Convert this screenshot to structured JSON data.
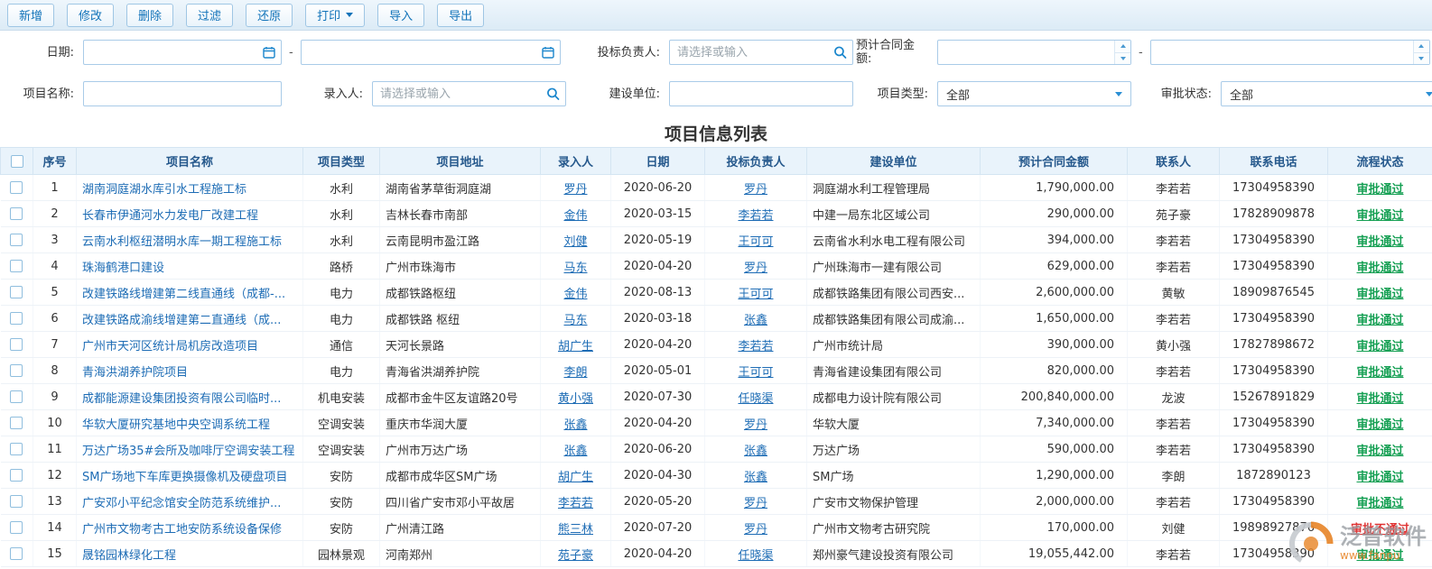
{
  "toolbar": {
    "buttons": [
      {
        "id": "add",
        "label": "新增",
        "dropdown": false
      },
      {
        "id": "edit",
        "label": "修改",
        "dropdown": false
      },
      {
        "id": "delete",
        "label": "删除",
        "dropdown": false
      },
      {
        "id": "filter",
        "label": "过滤",
        "dropdown": false
      },
      {
        "id": "restore",
        "label": "还原",
        "dropdown": false
      },
      {
        "id": "print",
        "label": "打印",
        "dropdown": true
      },
      {
        "id": "import",
        "label": "导入",
        "dropdown": false
      },
      {
        "id": "export",
        "label": "导出",
        "dropdown": false
      }
    ]
  },
  "filters": {
    "date_label": "日期:",
    "range_separator": "-",
    "bid_manager_label": "投标负责人:",
    "select_placeholder": "请选择或输入",
    "amount_label": "预计合同金额:",
    "project_name_label": "项目名称:",
    "entry_person_label": "录入人:",
    "construction_unit_label": "建设单位:",
    "project_type_label": "项目类型:",
    "project_type_value": "全部",
    "approval_status_label": "审批状态:",
    "approval_status_value": "全部"
  },
  "page_title": "项目信息列表",
  "table": {
    "columns": [
      "序号",
      "项目名称",
      "项目类型",
      "项目地址",
      "录入人",
      "日期",
      "投标负责人",
      "建设单位",
      "预计合同金额",
      "联系人",
      "联系电话",
      "流程状态"
    ],
    "rows": [
      {
        "no": "1",
        "name": "湖南洞庭湖水库引水工程施工标",
        "type": "水利",
        "address": "湖南省茅草街洞庭湖",
        "entry": "罗丹",
        "date": "2020-06-20",
        "bid": "罗丹",
        "unit": "洞庭湖水利工程管理局",
        "amount": "1,790,000.00",
        "contact": "李若若",
        "phone": "17304958390",
        "status": "审批通过",
        "status_state": "pass"
      },
      {
        "no": "2",
        "name": "长春市伊通河水力发电厂改建工程",
        "type": "水利",
        "address": "吉林长春市南部",
        "entry": "金伟",
        "date": "2020-03-15",
        "bid": "李若若",
        "unit": "中建一局东北区域公司",
        "amount": "290,000.00",
        "contact": "苑子豪",
        "phone": "17828909878",
        "status": "审批通过",
        "status_state": "pass"
      },
      {
        "no": "3",
        "name": "云南水利枢纽潜明水库一期工程施工标",
        "type": "水利",
        "address": "云南昆明市盈江路",
        "entry": "刘健",
        "date": "2020-05-19",
        "bid": "王可可",
        "unit": "云南省水利水电工程有限公司",
        "amount": "394,000.00",
        "contact": "李若若",
        "phone": "17304958390",
        "status": "审批通过",
        "status_state": "pass"
      },
      {
        "no": "4",
        "name": "珠海鹤港口建设",
        "type": "路桥",
        "address": "广州市珠海市",
        "entry": "马东",
        "date": "2020-04-20",
        "bid": "罗丹",
        "unit": "广州珠海市一建有限公司",
        "amount": "629,000.00",
        "contact": "李若若",
        "phone": "17304958390",
        "status": "审批通过",
        "status_state": "pass"
      },
      {
        "no": "5",
        "name": "改建铁路线增建第二线直通线（成都-...",
        "type": "电力",
        "address": "成都铁路枢纽",
        "entry": "金伟",
        "date": "2020-08-13",
        "bid": "王可可",
        "unit": "成都铁路集团有限公司西安...",
        "amount": "2,600,000.00",
        "contact": "黄敏",
        "phone": "18909876545",
        "status": "审批通过",
        "status_state": "pass"
      },
      {
        "no": "6",
        "name": "改建铁路成渝线增建第二直通线（成...",
        "type": "电力",
        "address": "成都铁路 枢纽",
        "entry": "马东",
        "date": "2020-03-18",
        "bid": "张鑫",
        "unit": "成都铁路集团有限公司成渝...",
        "amount": "1,650,000.00",
        "contact": "李若若",
        "phone": "17304958390",
        "status": "审批通过",
        "status_state": "pass"
      },
      {
        "no": "7",
        "name": "广州市天河区统计局机房改造项目",
        "type": "通信",
        "address": "天河长景路",
        "entry": "胡广生",
        "date": "2020-04-20",
        "bid": "李若若",
        "unit": "广州市统计局",
        "amount": "390,000.00",
        "contact": "黄小强",
        "phone": "17827898672",
        "status": "审批通过",
        "status_state": "pass"
      },
      {
        "no": "8",
        "name": "青海洪湖养护院项目",
        "type": "电力",
        "address": "青海省洪湖养护院",
        "entry": "李朗",
        "date": "2020-05-01",
        "bid": "王可可",
        "unit": "青海省建设集团有限公司",
        "amount": "820,000.00",
        "contact": "李若若",
        "phone": "17304958390",
        "status": "审批通过",
        "status_state": "pass"
      },
      {
        "no": "9",
        "name": "成都能源建设集团投资有限公司临时...",
        "type": "机电安装",
        "address": "成都市金牛区友谊路20号",
        "entry": "黄小强",
        "date": "2020-07-30",
        "bid": "任晓渠",
        "unit": "成都电力设计院有限公司",
        "amount": "200,840,000.00",
        "contact": "龙波",
        "phone": "15267891829",
        "status": "审批通过",
        "status_state": "pass"
      },
      {
        "no": "10",
        "name": "华软大厦研究基地中央空调系统工程",
        "type": "空调安装",
        "address": "重庆市华润大厦",
        "entry": "张鑫",
        "date": "2020-04-20",
        "bid": "罗丹",
        "unit": "华软大厦",
        "amount": "7,340,000.00",
        "contact": "李若若",
        "phone": "17304958390",
        "status": "审批通过",
        "status_state": "pass"
      },
      {
        "no": "11",
        "name": "万达广场35#会所及咖啡厅空调安装工程",
        "type": "空调安装",
        "address": "广州市万达广场",
        "entry": "张鑫",
        "date": "2020-06-20",
        "bid": "张鑫",
        "unit": "万达广场",
        "amount": "590,000.00",
        "contact": "李若若",
        "phone": "17304958390",
        "status": "审批通过",
        "status_state": "pass"
      },
      {
        "no": "12",
        "name": "SM广场地下车库更换摄像机及硬盘项目",
        "type": "安防",
        "address": "成都市成华区SM广场",
        "entry": "胡广生",
        "date": "2020-04-30",
        "bid": "张鑫",
        "unit": "SM广场",
        "amount": "1,290,000.00",
        "contact": "李朗",
        "phone": "1872890123",
        "status": "审批通过",
        "status_state": "pass"
      },
      {
        "no": "13",
        "name": "广安邓小平纪念馆安全防范系统维护...",
        "type": "安防",
        "address": "四川省广安市邓小平故居",
        "entry": "李若若",
        "date": "2020-05-20",
        "bid": "罗丹",
        "unit": "广安市文物保护管理",
        "amount": "2,000,000.00",
        "contact": "李若若",
        "phone": "17304958390",
        "status": "审批通过",
        "status_state": "pass"
      },
      {
        "no": "14",
        "name": "广州市文物考古工地安防系统设备保修",
        "type": "安防",
        "address": "广州清江路",
        "entry": "熊三林",
        "date": "2020-07-20",
        "bid": "罗丹",
        "unit": "广州市文物考古研究院",
        "amount": "170,000.00",
        "contact": "刘健",
        "phone": "19898927876",
        "status": "审批不通过",
        "status_state": "fail"
      },
      {
        "no": "15",
        "name": "晟铭园林绿化工程",
        "type": "园林景观",
        "address": "河南郑州",
        "entry": "苑子豪",
        "date": "2020-04-20",
        "bid": "任晓渠",
        "unit": "郑州豪气建设投资有限公司",
        "amount": "19,055,442.00",
        "contact": "李若若",
        "phone": "17304958390",
        "status": "审批通过",
        "status_state": "pass"
      }
    ]
  },
  "watermark": {
    "brand": "泛普软件",
    "site": "www.fanpu"
  },
  "colors": {
    "accent_blue": "#1273b9",
    "link_blue": "#1d6cb5",
    "header_bg": "#e9f3fb",
    "header_text": "#25588c",
    "pass_green": "#16a054",
    "fail_red": "#e03434",
    "watermark_orange": "#e8872c"
  }
}
